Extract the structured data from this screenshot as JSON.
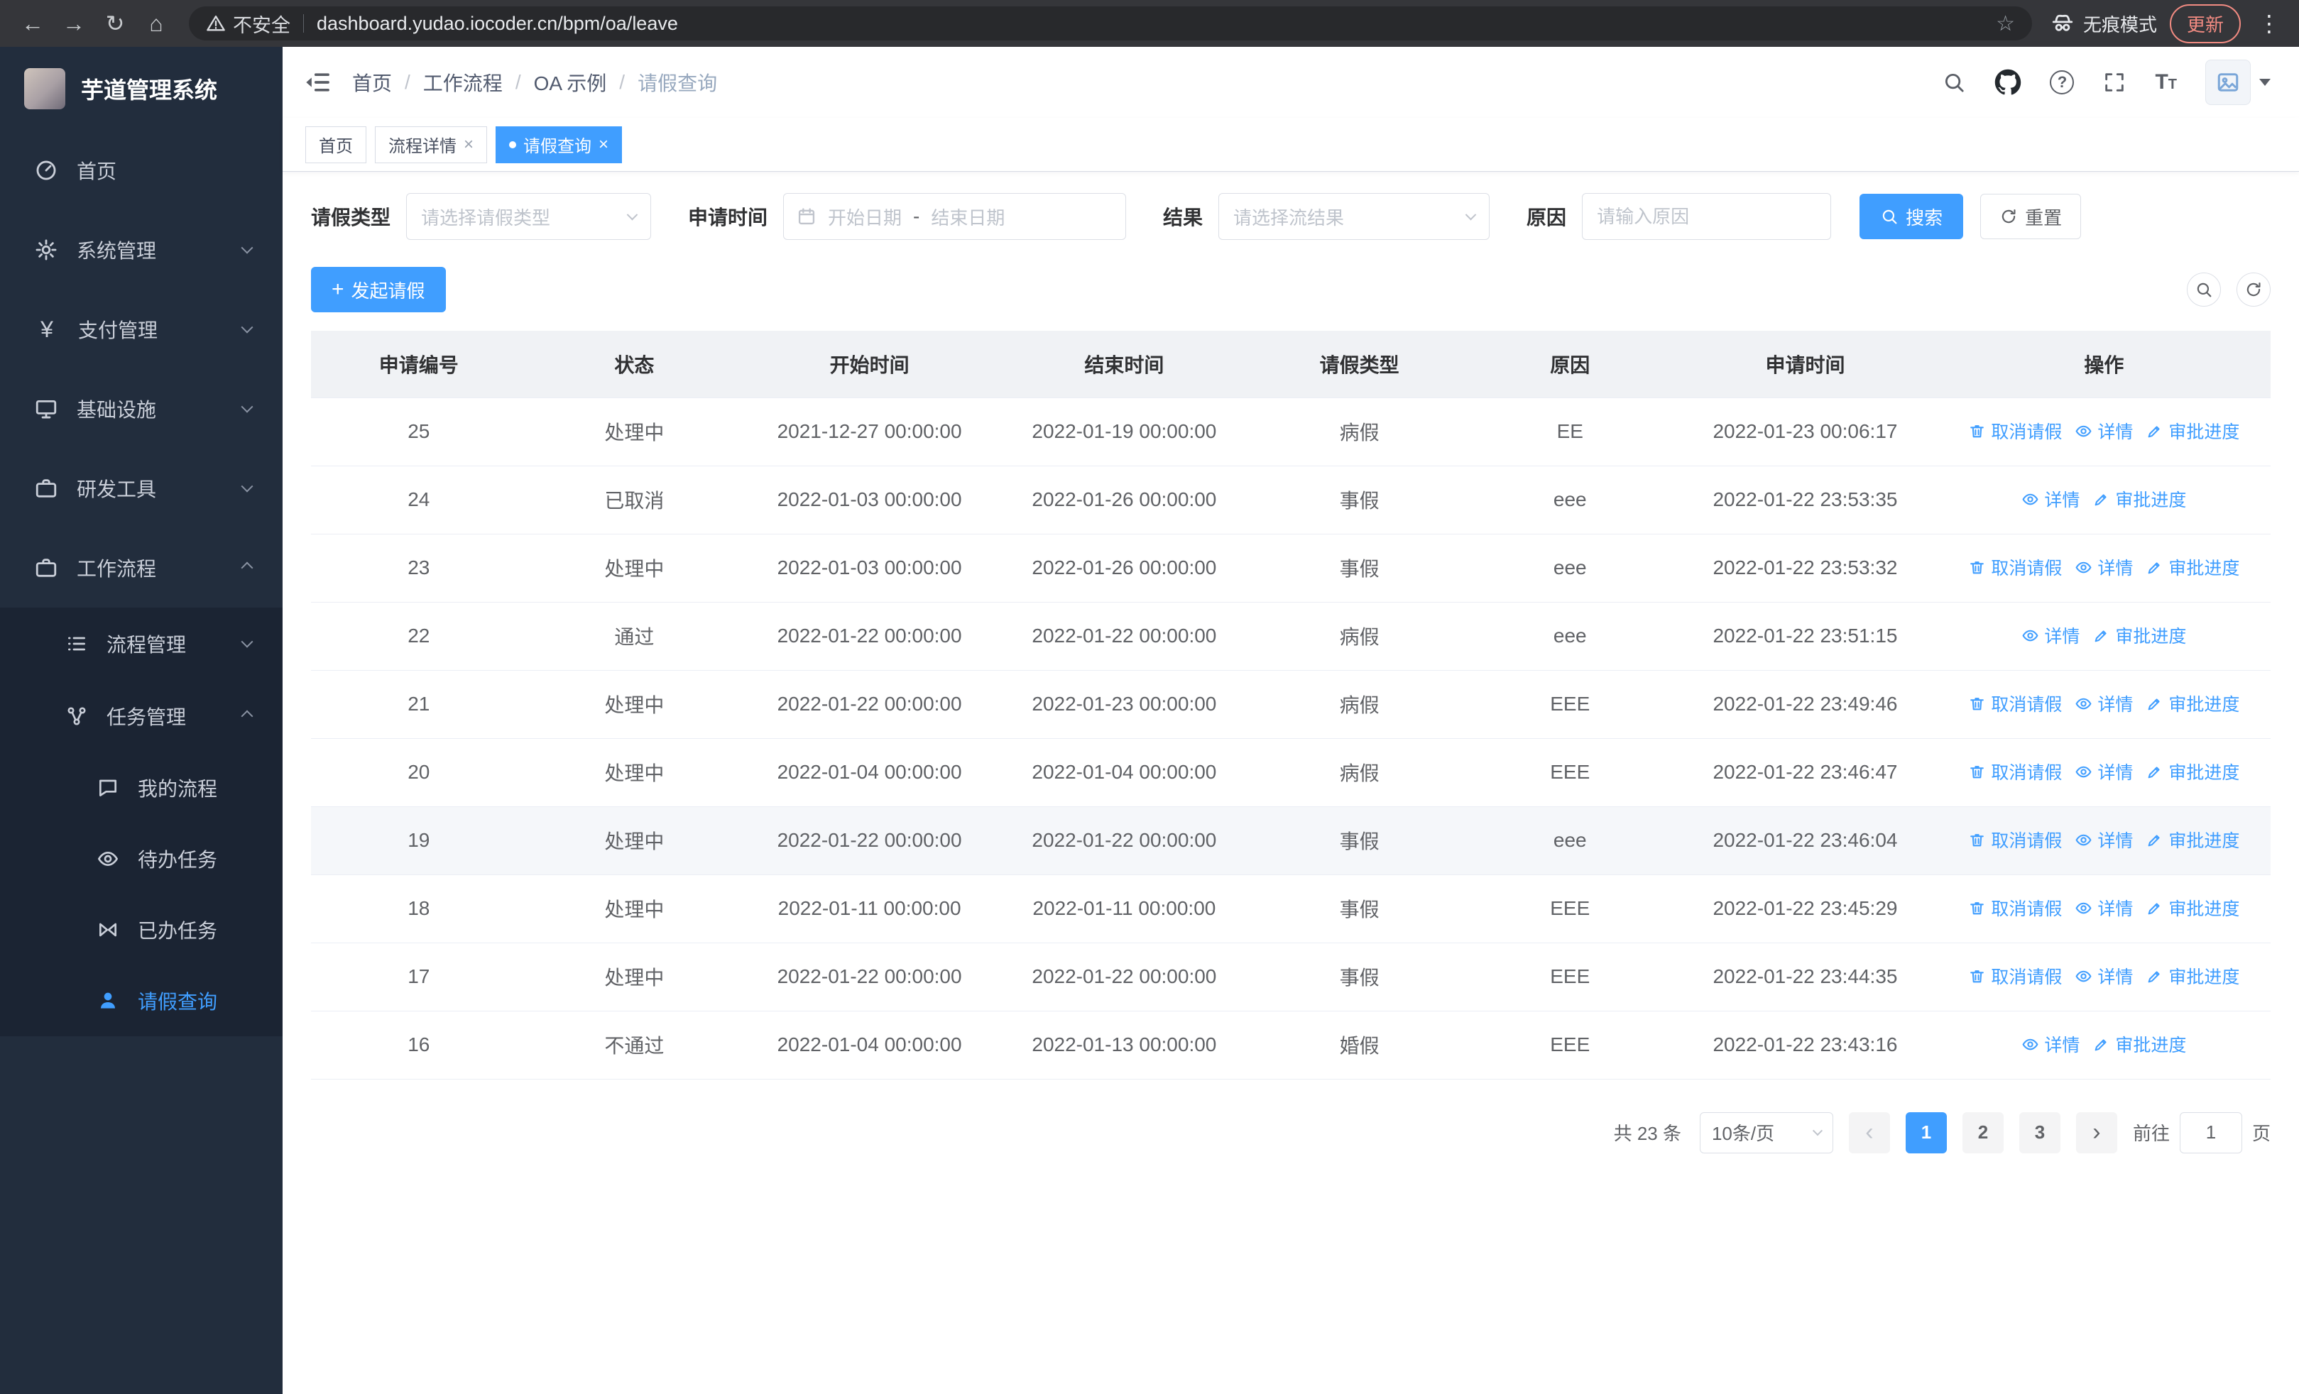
{
  "theme": {
    "primary": "#409eff",
    "sidebar_bg": "#222d3d",
    "table_header_bg": "#f0f2f5"
  },
  "browser": {
    "security_warning": "不安全",
    "url": "dashboard.yudao.iocoder.cn/bpm/oa/leave",
    "incognito_label": "无痕模式",
    "update_label": "更新"
  },
  "sidebar": {
    "app_title": "芋道管理系统",
    "items": [
      {
        "label": "首页",
        "icon": "gauge-icon"
      },
      {
        "label": "系统管理",
        "icon": "gear-icon"
      },
      {
        "label": "支付管理",
        "icon": "yen-icon"
      },
      {
        "label": "基础设施",
        "icon": "monitor-icon"
      },
      {
        "label": "研发工具",
        "icon": "briefcase-icon"
      },
      {
        "label": "工作流程",
        "icon": "workflow-icon",
        "children": [
          {
            "label": "流程管理",
            "icon": "list-icon"
          },
          {
            "label": "任务管理",
            "icon": "nodes-icon",
            "children": [
              {
                "label": "我的流程",
                "icon": "chat-icon"
              },
              {
                "label": "待办任务",
                "icon": "eye-icon"
              },
              {
                "label": "已办任务",
                "icon": "bowtie-icon"
              },
              {
                "label": "请假查询",
                "icon": "person-icon",
                "active": true
              }
            ]
          }
        ]
      }
    ]
  },
  "header": {
    "breadcrumb": [
      "首页",
      "工作流程",
      "OA 示例",
      "请假查询"
    ]
  },
  "tabs": [
    {
      "label": "首页",
      "closable": false,
      "active": false
    },
    {
      "label": "流程详情",
      "closable": true,
      "active": false
    },
    {
      "label": "请假查询",
      "closable": true,
      "active": true
    }
  ],
  "filters": {
    "leave_type_label": "请假类型",
    "leave_type_placeholder": "请选择请假类型",
    "apply_time_label": "申请时间",
    "date_start_placeholder": "开始日期",
    "date_separator": "-",
    "date_end_placeholder": "结束日期",
    "result_label": "结果",
    "result_placeholder": "请选择流结果",
    "reason_label": "原因",
    "reason_placeholder": "请输入原因",
    "search_label": "搜索",
    "reset_label": "重置"
  },
  "toolbar": {
    "create_label": "发起请假"
  },
  "table": {
    "columns": [
      "申请编号",
      "状态",
      "开始时间",
      "结束时间",
      "请假类型",
      "原因",
      "申请时间",
      "操作"
    ],
    "actions": {
      "cancel": "取消请假",
      "detail": "详情",
      "progress": "审批进度"
    },
    "rows": [
      {
        "id": "25",
        "status": "处理中",
        "start": "2021-12-27 00:00:00",
        "end": "2022-01-19 00:00:00",
        "type": "病假",
        "reason": "EE",
        "applied": "2022-01-23 00:06:17",
        "cancellable": true
      },
      {
        "id": "24",
        "status": "已取消",
        "start": "2022-01-03 00:00:00",
        "end": "2022-01-26 00:00:00",
        "type": "事假",
        "reason": "eee",
        "applied": "2022-01-22 23:53:35",
        "cancellable": false
      },
      {
        "id": "23",
        "status": "处理中",
        "start": "2022-01-03 00:00:00",
        "end": "2022-01-26 00:00:00",
        "type": "事假",
        "reason": "eee",
        "applied": "2022-01-22 23:53:32",
        "cancellable": true
      },
      {
        "id": "22",
        "status": "通过",
        "start": "2022-01-22 00:00:00",
        "end": "2022-01-22 00:00:00",
        "type": "病假",
        "reason": "eee",
        "applied": "2022-01-22 23:51:15",
        "cancellable": false
      },
      {
        "id": "21",
        "status": "处理中",
        "start": "2022-01-22 00:00:00",
        "end": "2022-01-23 00:00:00",
        "type": "病假",
        "reason": "EEE",
        "applied": "2022-01-22 23:49:46",
        "cancellable": true
      },
      {
        "id": "20",
        "status": "处理中",
        "start": "2022-01-04 00:00:00",
        "end": "2022-01-04 00:00:00",
        "type": "病假",
        "reason": "EEE",
        "applied": "2022-01-22 23:46:47",
        "cancellable": true
      },
      {
        "id": "19",
        "status": "处理中",
        "start": "2022-01-22 00:00:00",
        "end": "2022-01-22 00:00:00",
        "type": "事假",
        "reason": "eee",
        "applied": "2022-01-22 23:46:04",
        "cancellable": true
      },
      {
        "id": "18",
        "status": "处理中",
        "start": "2022-01-11 00:00:00",
        "end": "2022-01-11 00:00:00",
        "type": "事假",
        "reason": "EEE",
        "applied": "2022-01-22 23:45:29",
        "cancellable": true
      },
      {
        "id": "17",
        "status": "处理中",
        "start": "2022-01-22 00:00:00",
        "end": "2022-01-22 00:00:00",
        "type": "事假",
        "reason": "EEE",
        "applied": "2022-01-22 23:44:35",
        "cancellable": true
      },
      {
        "id": "16",
        "status": "不通过",
        "start": "2022-01-04 00:00:00",
        "end": "2022-01-13 00:00:00",
        "type": "婚假",
        "reason": "EEE",
        "applied": "2022-01-22 23:43:16",
        "cancellable": false
      }
    ]
  },
  "pagination": {
    "total_text": "共 23 条",
    "page_size": "10条/页",
    "pages": [
      "1",
      "2",
      "3"
    ],
    "active_page": "1",
    "goto_label": "前往",
    "goto_value": "1",
    "page_label": "页"
  }
}
